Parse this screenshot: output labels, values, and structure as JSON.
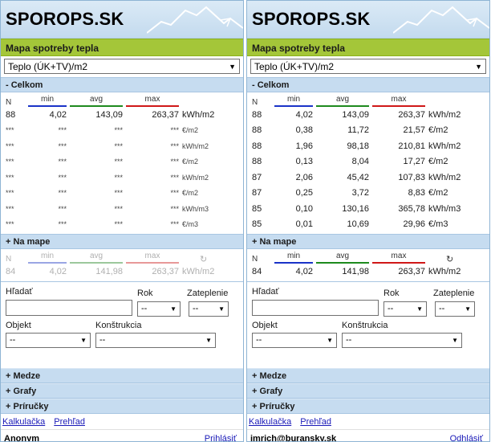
{
  "brand": "SPOROPS.SK",
  "map_title": "Mapa spotreby tepla",
  "metric_select": "Teplo (ÚK+TV)/m2",
  "sections": {
    "celkom_collapse": "- Celkom",
    "na_mape_expand": "+ Na mape"
  },
  "columns": {
    "n": "N",
    "min": "min",
    "avg": "avg",
    "max": "max"
  },
  "left": {
    "celkom_rows": [
      {
        "n": "88",
        "min": "4,02",
        "avg": "143,09",
        "max": "263,37",
        "unit": "kWh/m2"
      },
      {
        "n": "***",
        "min": "***",
        "avg": "***",
        "max": "***",
        "unit": "€/m2"
      },
      {
        "n": "***",
        "min": "***",
        "avg": "***",
        "max": "***",
        "unit": "kWh/m2"
      },
      {
        "n": "***",
        "min": "***",
        "avg": "***",
        "max": "***",
        "unit": "€/m2"
      },
      {
        "n": "***",
        "min": "***",
        "avg": "***",
        "max": "***",
        "unit": "kWh/m2"
      },
      {
        "n": "***",
        "min": "***",
        "avg": "***",
        "max": "***",
        "unit": "€/m2"
      },
      {
        "n": "***",
        "min": "***",
        "avg": "***",
        "max": "***",
        "unit": "kWh/m3"
      },
      {
        "n": "***",
        "min": "***",
        "avg": "***",
        "max": "***",
        "unit": "€/m3"
      }
    ],
    "na_mape_row": {
      "n": "84",
      "min": "4,02",
      "avg": "141,98",
      "max": "263,37",
      "unit": "kWh/m2"
    },
    "user": "Anonym",
    "auth_link": "Prihlásiť"
  },
  "right": {
    "celkom_rows": [
      {
        "n": "88",
        "min": "4,02",
        "avg": "143,09",
        "max": "263,37",
        "unit": "kWh/m2"
      },
      {
        "n": "88",
        "min": "0,38",
        "avg": "11,72",
        "max": "21,57",
        "unit": "€/m2"
      },
      {
        "n": "88",
        "min": "1,96",
        "avg": "98,18",
        "max": "210,81",
        "unit": "kWh/m2"
      },
      {
        "n": "88",
        "min": "0,13",
        "avg": "8,04",
        "max": "17,27",
        "unit": "€/m2"
      },
      {
        "n": "87",
        "min": "2,06",
        "avg": "45,42",
        "max": "107,83",
        "unit": "kWh/m2"
      },
      {
        "n": "87",
        "min": "0,25",
        "avg": "3,72",
        "max": "8,83",
        "unit": "€/m2"
      },
      {
        "n": "85",
        "min": "0,10",
        "avg": "130,16",
        "max": "365,78",
        "unit": "kWh/m3"
      },
      {
        "n": "85",
        "min": "0,01",
        "avg": "10,69",
        "max": "29,96",
        "unit": "€/m3"
      }
    ],
    "na_mape_row": {
      "n": "84",
      "min": "4,02",
      "avg": "141,98",
      "max": "263,37",
      "unit": "kWh/m2"
    },
    "user": "imrich@buransky.sk",
    "auth_link": "Odhlásiť"
  },
  "form": {
    "search_label": "Hľadať",
    "search_value": "",
    "rok_label": "Rok",
    "zateplenie_label": "Zateplenie",
    "objekt_label": "Objekt",
    "konstrukcia_label": "Konštrukcia",
    "dash": "--"
  },
  "collapsed_sections": [
    "+ Medze",
    "+ Grafy",
    "+ Príručky"
  ],
  "links": {
    "calculator": "Kalkulačka",
    "overview": "Prehľad"
  },
  "icons": {
    "dropdown": "triangle-down-icon",
    "reload": "reload-icon"
  },
  "colors": {
    "min": "#1a33c8",
    "avg": "#1e8a1e",
    "max": "#d01818",
    "green_bar": "#a4c639",
    "section": "#c6dcf0"
  }
}
